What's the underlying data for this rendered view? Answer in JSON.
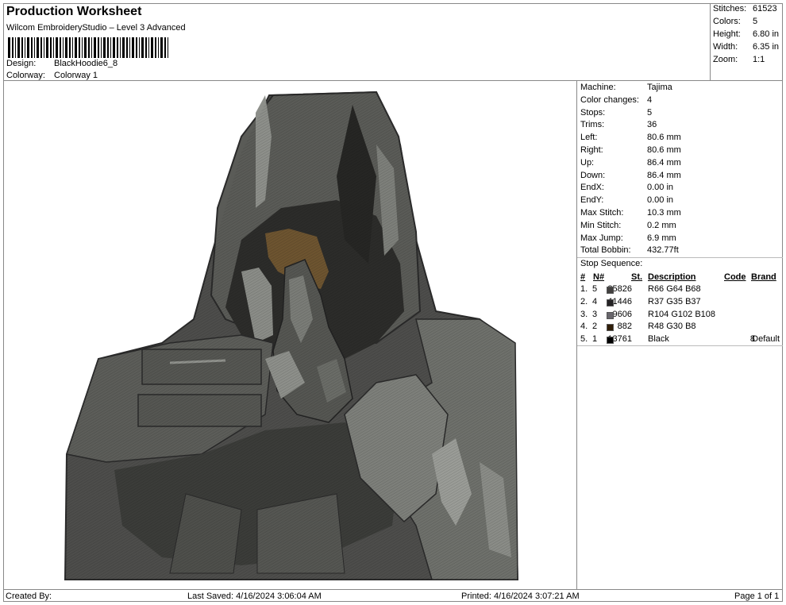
{
  "header": {
    "title": "Production Worksheet",
    "subtitle": "Wilcom EmbroideryStudio – Level 3 Advanced",
    "design_label": "Design:",
    "design_value": "BlackHoodie6_8",
    "colorway_label": "Colorway:",
    "colorway_value": "Colorway 1"
  },
  "summary": {
    "stitches_label": "Stitches:",
    "stitches_value": "61523",
    "colors_label": "Colors:",
    "colors_value": "5",
    "height_label": "Height:",
    "height_value": "6.80 in",
    "width_label": "Width:",
    "width_value": "6.35 in",
    "zoom_label": "Zoom:",
    "zoom_value": "1:1"
  },
  "machine_info": [
    {
      "label": "Machine:",
      "value": "Tajima"
    },
    {
      "label": "Color changes:",
      "value": "4"
    },
    {
      "label": "Stops:",
      "value": "5"
    },
    {
      "label": "Trims:",
      "value": "36"
    },
    {
      "label": "Left:",
      "value": "80.6 mm"
    },
    {
      "label": "Right:",
      "value": "80.6 mm"
    },
    {
      "label": "Up:",
      "value": "86.4 mm"
    },
    {
      "label": "Down:",
      "value": "86.4 mm"
    },
    {
      "label": "EndX:",
      "value": "0.00 in"
    },
    {
      "label": "EndY:",
      "value": "0.00 in"
    },
    {
      "label": "Max Stitch:",
      "value": "10.3 mm"
    },
    {
      "label": "Min Stitch:",
      "value": "0.2 mm"
    },
    {
      "label": "Max Jump:",
      "value": "6.9 mm"
    },
    {
      "label": "Total Bobbin:",
      "value": "432.77ft"
    }
  ],
  "stop_sequence": {
    "title": "Stop Sequence:",
    "headers": {
      "num": "#",
      "n": "N#",
      "st": "St.",
      "description": "Description",
      "code": "Code",
      "brand": "Brand"
    },
    "rows": [
      {
        "num": "1.",
        "n": "5",
        "color": "#42403F",
        "st": "25826",
        "description": "R66 G64 B68",
        "code": "",
        "brand": ""
      },
      {
        "num": "2.",
        "n": "4",
        "color": "#252325",
        "st": "11446",
        "description": "R37 G35 B37",
        "code": "",
        "brand": ""
      },
      {
        "num": "3.",
        "n": "3",
        "color": "#68666C",
        "st": "9606",
        "description": "R104 G102 B108",
        "code": "",
        "brand": ""
      },
      {
        "num": "4.",
        "n": "2",
        "color": "#301E08",
        "st": "882",
        "description": "R48 G30 B8",
        "code": "",
        "brand": ""
      },
      {
        "num": "5.",
        "n": "1",
        "color": "#000000",
        "st": "13761",
        "description": "Black",
        "code": "8",
        "brand": "Default"
      }
    ]
  },
  "footer": {
    "created_by": "Created By:",
    "last_saved": "Last Saved: 4/16/2024 3:06:04 AM",
    "printed": "Printed: 4/16/2024 3:07:21 AM",
    "page": "Page 1 of 1"
  }
}
